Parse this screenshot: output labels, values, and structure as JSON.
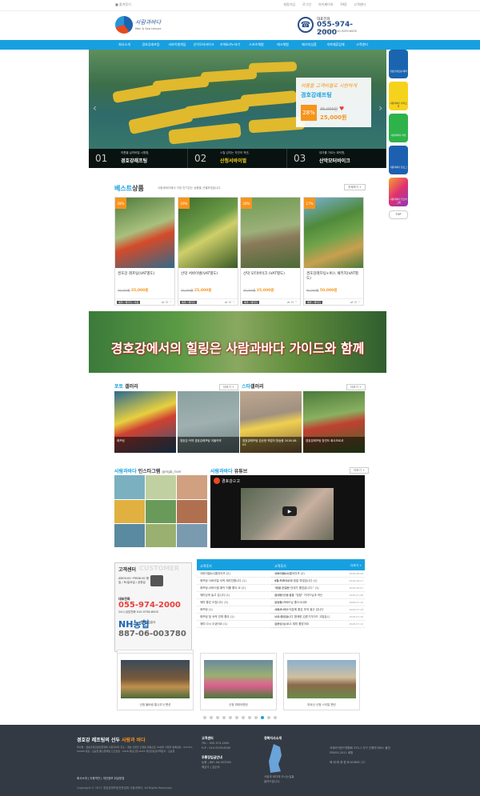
{
  "util": {
    "favorite": "■ 즐겨찾기",
    "links": [
      "회원가입",
      "로그인",
      "마이페이지",
      "FAQ",
      "고객센터"
    ]
  },
  "logo": {
    "main": "사람과바다",
    "sub": "Men & Sea Leisure"
  },
  "phone": {
    "label": "대표전화",
    "number": "055-974-2000",
    "hours": "24시 상담전화 010-9259-6000"
  },
  "nav": [
    "회사소개",
    "경호강래프팅",
    "서바이벌게임",
    "산악모터바이크",
    "카약&카누타기",
    "스포츠체험",
    "레크체험",
    "패키지상품",
    "숙박제휴업체",
    "고객센터"
  ],
  "hero": {
    "promo": {
      "headline": "여름을 고객비율로 시원하게",
      "title": "경호강래프팅",
      "pct": "28%",
      "old": "35,000원",
      "new": "25,000원"
    },
    "tabs": [
      {
        "n": "01",
        "s": "여름을 날려버릴 시원함,",
        "m": "경호강래프팅"
      },
      {
        "n": "02",
        "s": "스릴 넘치는 자연의 액션,",
        "m": "산청서바이벌"
      },
      {
        "n": "03",
        "s": "대자를 가르는 짜릿함,",
        "m": "산악모터바이크"
      }
    ]
  },
  "quick": [
    "경호강래프팅 예약",
    "사람과바다 카카오톡",
    "사람과바다 라인",
    "사람과바다 블로그",
    "사람과바다 인스타그램",
    "TOP"
  ],
  "best": {
    "title_a": "베스트",
    "title_b": "상품",
    "sub": "사람과바다에서 가장 인기있는 상품을 선별하였습니다.",
    "more": "전체보기 +",
    "items": [
      {
        "badge": "28%",
        "name": "경호강 래프팅(VAT별도)",
        "old": "35,000원",
        "new": "25,000원",
        "tag": "예약 / 패키지 / 이용"
      },
      {
        "badge": "29%",
        "name": "산악 서바이벌(VAT별도)",
        "old": "35,000원",
        "new": "25,000원",
        "tag": "예약 / 패키지"
      },
      {
        "badge": "28%",
        "name": "산악 모터바이크 (VAT별도)",
        "old": "35,000원",
        "new": "25,000원",
        "tag": "예약 / 패키지"
      },
      {
        "badge": "17%",
        "name": "경호강래프팅+버스 패키지(VAT별도)",
        "old": "60,000원",
        "new": "50,000원",
        "tag": "예약 / 패키지"
      }
    ]
  },
  "banner": {
    "text": "경호강에서의 힐링은 사람과바다 가이드와 함께"
  },
  "gallery": {
    "photo": {
      "a": "포토",
      "b": " 갤러리",
      "more": "더보기 +"
    },
    "star": {
      "a": "스타",
      "b": "갤러리",
      "more": "더보기 +"
    },
    "items": [
      "래프팅",
      "경호강 카약 경호강래프팅 겨울카약",
      "경호강래프팅 김순현 작업처 방송중 2018-08-03",
      "경호강래프팅 방연도 회사모르셔"
    ]
  },
  "social": {
    "insta_a": "사람과바다",
    "insta_b": " 인스타그램",
    "insta_id": "@mgb_river",
    "yt_a": "사람과바다",
    "yt_b": " 유튜브",
    "yt_title": "경호강ㄹ고",
    "more": "더보기 +"
  },
  "cs": {
    "title": "고객센터",
    "title_en": "CUSTOMER",
    "hours": "AM09:00~PM06:00 평일 / 토/일요일 / 공휴일",
    "label": "대표전화",
    "number": "055-974-2000",
    "s24": "24시 상담전화 010-9738-6000",
    "nh": "NH농협",
    "nh2": "예금주 김춘아",
    "acct": "887-06-003780"
  },
  "board1": {
    "title": "고객후기",
    "more": "더보기 +",
    "rows": [
      [
        "사바이벌&사롱어이즈 (2)",
        "2018-08-26"
      ],
      [
        "래프팅 사바이벌 숙박 재추천합니다 (1)",
        "2018-07-19"
      ],
      [
        "래프팅-서바이벌 패키 지를 좋아 요 (2)",
        "2018-07-18"
      ],
      [
        "재미있게 놀고 갑니다 (1)",
        "2018-07-11"
      ],
      [
        "재미 좋은 도립니다. (1)",
        "2018-07-11"
      ],
      [
        "래프팅 (1)",
        "2018-07-11"
      ],
      [
        "래프팅 및 숙박 전체 좋아 (1)",
        "2018-07-06"
      ],
      [
        "재미 다시 오셨어요 (1)",
        "2018-07-06"
      ]
    ]
  },
  "board2": {
    "title": "고객후기",
    "more": "더보기 +",
    "rows": [
      [
        "사바이벌&사롱어이즈 (2)",
        "2018-08-26"
      ],
      [
        "8월 프레이르페 정말 하였습니다 (1)",
        "2018-08-17"
      ],
      [
        "\"정말 친절한 안내가 좋았습니다.\" (1)",
        "2018-08-07"
      ],
      [
        "집대형 선생 뜰을 \"정말\" 가이드님과 하는",
        "2018-07-26"
      ],
      [
        "입당할 가이드님 좋으시네요",
        "2018-07-19"
      ],
      [
        "사람과 바다 덕분에 좋은 추억 쌓고 갑니다",
        "2018-07-18"
      ],
      [
        "너무 좋았습니다 함께한 김준기가이드 고맙습니",
        "2018-07-16"
      ],
      [
        "김준성 님 오고 재미 좋았어요",
        "2018-07-12"
      ]
    ]
  },
  "pension": {
    "title": "숙박제휴업체",
    "items": [
      "산청 불바람 통나무식 펜션",
      "산청 파파야펜션",
      "하트산 산청 스타일 펜션"
    ]
  },
  "footer": {
    "t_a": "경호강 레프팅의 선두 ",
    "t_b": "사람과 바다",
    "addr": "회사명 : 경호강래프팅전문업체 사람과바다 주소 : 경남 산청군 산청읍 꽃봉산로 39번지 사업자 등록번호 : 613-81-04426 대표 : 김순현 통신판매업 신고번호 : 2016-경남산청-0015 개인정보관리책임자 : 김순현",
    "links": "회사소개 | 이용약관 | 개인정보 취급방침",
    "copy": "Copyright © 2017 경호강래프팅전문업체 사람과바다. All Rights Reserved.",
    "c1": {
      "h": "고객센터",
      "l1": "TEL : 055-974-2000",
      "l2": "H.P : 010-9259-6000"
    },
    "c2": {
      "h": "무통장입금안내",
      "l1": "농협 | 887-06-003780",
      "l2": "예금주 | 김순아"
    },
    "c3": {
      "h": "경북지사소개",
      "l1": "사람과 바다에 오시는길을",
      "l2": "알려드립니다."
    },
    "c4": {
      "l1": "국제카이운드맨협회 333-1 지구 선행자이비스 물전",
      "l2": "FEBOS-2011 회원",
      "l3": "해 래 래 래 협 회 KORMC.CC"
    }
  }
}
